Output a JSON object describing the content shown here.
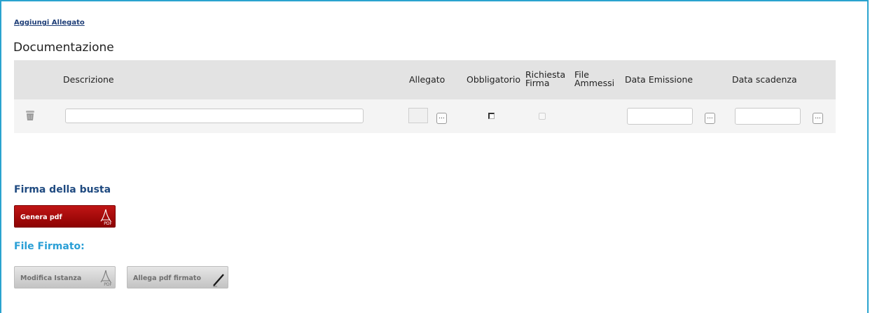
{
  "links": {
    "add_attachment": "Aggiungi Allegato"
  },
  "section": {
    "title": "Documentazione"
  },
  "table": {
    "headers": {
      "descrizione": "Descrizione",
      "allegato": "Allegato",
      "obbligatorio": "Obbligatorio",
      "richiesta_1": "Richiesta",
      "richiesta_2": "Firma",
      "file_1": "File",
      "file_2": "Ammessi",
      "data_emissione": "Data Emissione",
      "data_scadenza": "Data scadenza"
    },
    "row": {
      "descrizione_value": "",
      "allegato_dots": "...",
      "data_emissione_value": "",
      "data_scadenza_value": "",
      "dots": "..."
    }
  },
  "firma": {
    "title": "Firma della busta",
    "genera_pdf": "Genera pdf",
    "pdf_caption": "PDF"
  },
  "file_firmato": {
    "title": "File Firmato:",
    "modifica_istanza": "Modifica Istanza",
    "allega_pdf_firmato": "Allega pdf firmato",
    "pdf_caption": "PDF"
  },
  "colors": {
    "frame_border": "#2aa3cf",
    "link": "#1f3f78",
    "firma_title": "#1f4a80",
    "file_firmato_title": "#2a9fd6",
    "primary_button": "#b00c0c",
    "disabled_button": "#d6d6d6"
  },
  "icons": [
    "trash-icon",
    "pdf-icon",
    "pen-icon",
    "ellipsis-icon"
  ]
}
